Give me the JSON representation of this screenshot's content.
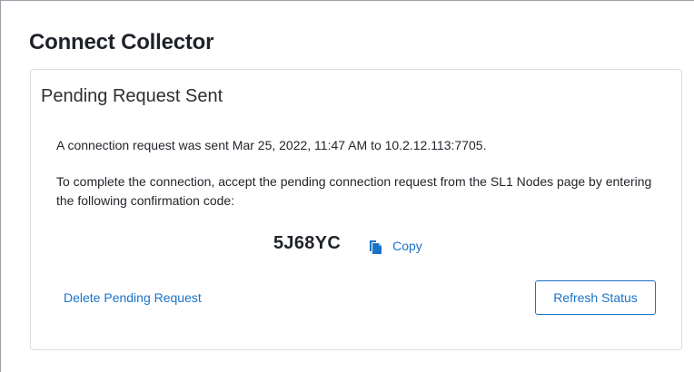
{
  "page": {
    "title": "Connect Collector"
  },
  "card": {
    "title": "Pending Request Sent",
    "sent_message": "A connection request was sent Mar 25, 2022, 11:47 AM to 10.2.12.113:7705.",
    "instructions": "To complete the connection, accept the pending connection request from the SL1 Nodes page by entering the following confirmation code:",
    "confirmation_code": "5J68YC",
    "copy_label": "Copy",
    "copy_icon": "copy-icon",
    "delete_label": "Delete Pending Request",
    "refresh_label": "Refresh Status"
  },
  "colors": {
    "accent": "#1a73c8",
    "text": "#1f2329",
    "card_border": "#d9dce0"
  }
}
